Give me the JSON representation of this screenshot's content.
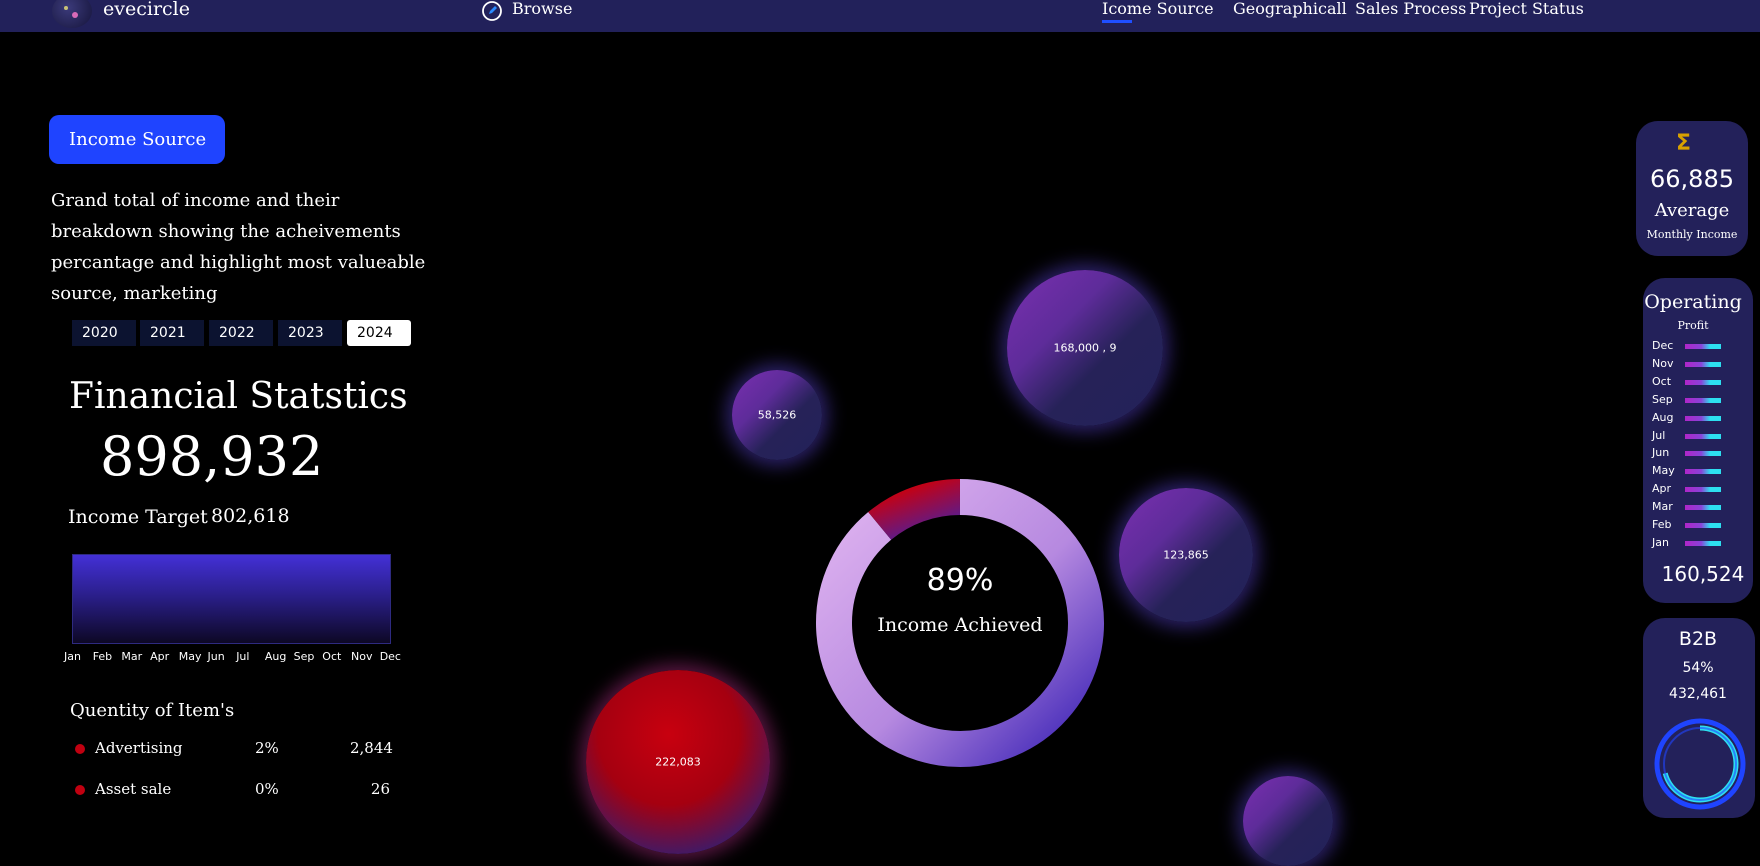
{
  "topbar": {
    "brand": "evecircle",
    "browse_label": "Browse",
    "nav": [
      "Icome Source",
      "Geographicall",
      "Sales Process",
      "Project Status"
    ]
  },
  "sidebar": {
    "income_button_label": "Income Source",
    "description": "Grand total of income and their breakdown showing the acheivements percantage and highlight most valueable source, marketing",
    "years": [
      "2020",
      "2021",
      "2022",
      "2023",
      "2024"
    ],
    "selected_year": "2024",
    "financial_title": "Financial Statstics",
    "financial_total": "898,932",
    "income_target_label": "Income Target",
    "income_target_value": "802,618",
    "months": [
      "Jan",
      "Feb",
      "Mar",
      "Apr",
      "May",
      "Jun",
      "Jul",
      "Aug",
      "Sep",
      "Oct",
      "Nov",
      "Dec"
    ],
    "quantity_title": "Quentity of Item's",
    "quantity_rows": [
      {
        "name": "Advertising",
        "percent": "2%",
        "value": "2,844"
      },
      {
        "name": "Asset sale",
        "percent": "0%",
        "value": "26"
      }
    ]
  },
  "bubbles": [
    "58,526",
    "168,000 , 9",
    "123,865",
    "222,083"
  ],
  "donut": {
    "percent": "89%",
    "label": "Income Achieved",
    "achieved_fraction": 0.89
  },
  "kpi_average": {
    "icon": "sigma-icon",
    "value": "66,885",
    "label": "Average",
    "sublabel": "Monthly Income"
  },
  "kpi_operating": {
    "title": "Operating",
    "subtitle": "Profit",
    "months": [
      "Dec",
      "Nov",
      "Oct",
      "Sep",
      "Aug",
      "Jul",
      "Jun",
      "May",
      "Apr",
      "Mar",
      "Feb",
      "Jan"
    ],
    "total": "160,524"
  },
  "kpi_b2b": {
    "title": "B2B",
    "percent": "54%",
    "value": "432,461"
  },
  "colors": {
    "topbar": "#22215a",
    "accent_blue": "#1f44ff",
    "card": "#23215a",
    "red": "#c8000f",
    "purple": "#7a2fb0",
    "cyan": "#2de0f0",
    "gold": "#d8a100"
  }
}
